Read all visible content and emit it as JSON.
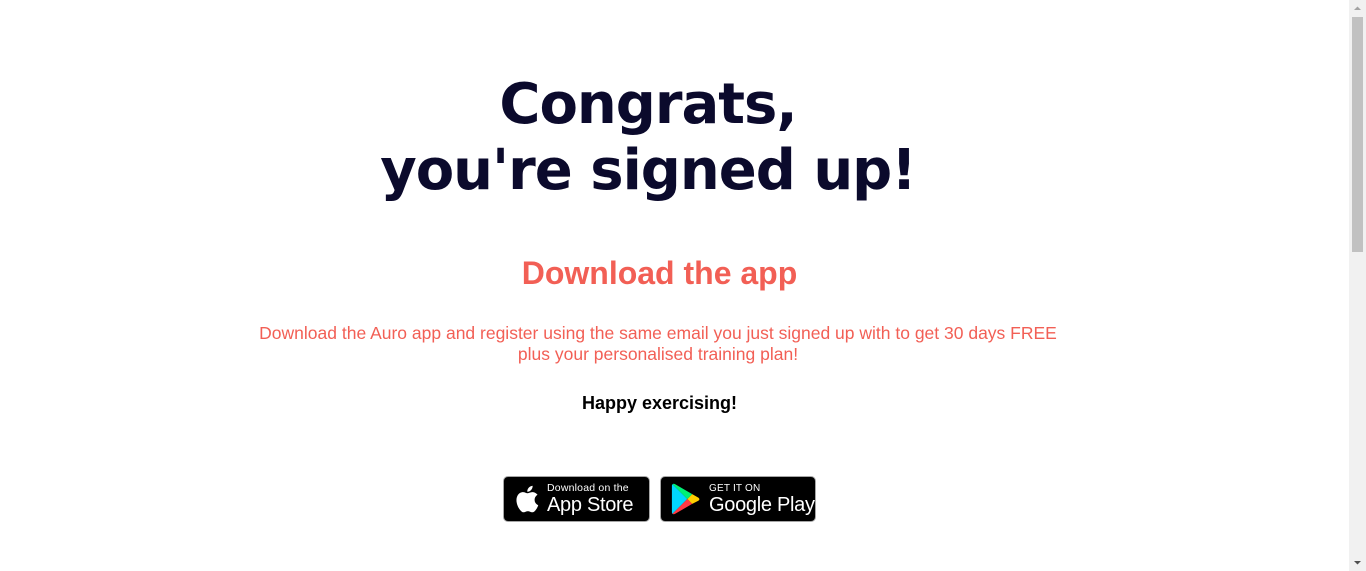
{
  "hero": {
    "headline_line1": "Congrats,",
    "headline_line2": "you're signed up!",
    "subheading": "Download the app",
    "description_line1": "Download the Auro app and register using the same email you just signed up with to get 30 days FREE",
    "description_line2": "plus your personalised training plan!",
    "closing": "Happy exercising!"
  },
  "badges": {
    "app_store": {
      "small": "Download on the",
      "large": "App Store",
      "icon": "apple-icon"
    },
    "google_play": {
      "small": "GET IT ON",
      "large": "Google Play",
      "icon": "google-play-icon"
    }
  },
  "colors": {
    "headline": "#0b0a2c",
    "accent": "#f25f55",
    "badge_bg": "#000000"
  }
}
